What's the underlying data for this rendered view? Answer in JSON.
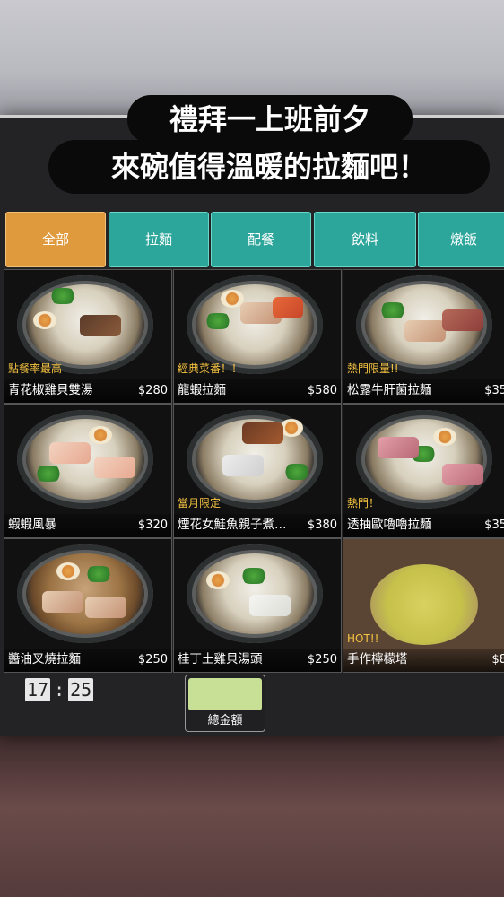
{
  "caption": {
    "line1": "禮拜一上班前夕",
    "line2": "來碗值得溫暖的拉麵吧！"
  },
  "tabs": [
    {
      "label": "全部",
      "active": true
    },
    {
      "label": "拉麵",
      "active": false
    },
    {
      "label": "配餐",
      "active": false
    },
    {
      "label": "飲料",
      "active": false
    },
    {
      "label": "燉飯",
      "active": false
    }
  ],
  "menu": [
    {
      "name": "青花椒雞貝雙湯",
      "price": "$280",
      "badge": "點餐率最高"
    },
    {
      "name": "龍蝦拉麵",
      "price": "$580",
      "badge": "經典菜番！！"
    },
    {
      "name": "松露牛肝菌拉麵",
      "price": "$35",
      "badge": "熱門限量!!"
    },
    {
      "name": "蝦蝦風暴",
      "price": "$320",
      "badge": ""
    },
    {
      "name": "煙花女鮭魚親子煮…",
      "price": "$380",
      "badge": "當月限定"
    },
    {
      "name": "透抽歐嚕嚕拉麵",
      "price": "$35",
      "badge": "熱門！"
    },
    {
      "name": "醬油叉燒拉麵",
      "price": "$250",
      "badge": ""
    },
    {
      "name": "桂丁土雞貝湯頭",
      "price": "$250",
      "badge": ""
    },
    {
      "name": "手作檸檬塔",
      "price": "$8",
      "badge": "HOT!!"
    }
  ],
  "clock": {
    "hours": "17",
    "separator": ":",
    "minutes": "25"
  },
  "total": {
    "label": "總金額",
    "swatch_color": "#c8df96"
  },
  "colors": {
    "tab_active": "#e09a3e",
    "tab": "#2ca59a",
    "badge": "#f5c342"
  }
}
